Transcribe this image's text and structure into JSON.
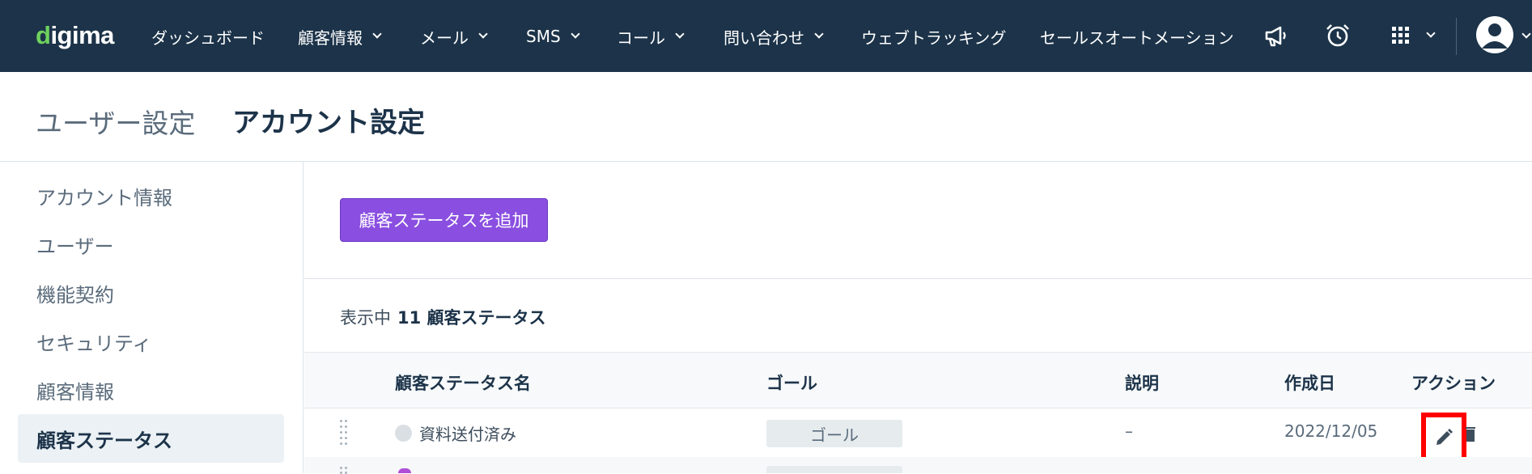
{
  "brand": {
    "logo_text": "digima",
    "leaf_color": "#6fd15e"
  },
  "nav": {
    "items": [
      {
        "label": "ダッシュボード",
        "has_dropdown": false
      },
      {
        "label": "顧客情報",
        "has_dropdown": true
      },
      {
        "label": "メール",
        "has_dropdown": true
      },
      {
        "label": "SMS",
        "has_dropdown": true
      },
      {
        "label": "コール",
        "has_dropdown": true
      },
      {
        "label": "問い合わせ",
        "has_dropdown": true
      },
      {
        "label": "ウェブトラッキング",
        "has_dropdown": false
      },
      {
        "label": "セールスオートメーション",
        "has_dropdown": false
      }
    ],
    "icons": [
      "megaphone-icon",
      "alarm-clock-icon",
      "app-grid-icon",
      "user-avatar-icon"
    ],
    "background": "#1c3349"
  },
  "header": {
    "breadcrumb_parent": "ユーザー設定",
    "page_title": "アカウント設定"
  },
  "sidebar": {
    "items": [
      {
        "label": "アカウント情報",
        "active": false
      },
      {
        "label": "ユーザー",
        "active": false
      },
      {
        "label": "機能契約",
        "active": false
      },
      {
        "label": "セキュリティ",
        "active": false
      },
      {
        "label": "顧客情報",
        "active": false
      },
      {
        "label": "顧客ステータス",
        "active": true
      }
    ]
  },
  "main": {
    "add_button_label": "顧客ステータスを追加",
    "add_button_color": "#8a4fe0",
    "count": {
      "prefix": "表示中",
      "value": "11 顧客ステータス"
    },
    "table": {
      "headers": [
        "顧客ステータス名",
        "ゴール",
        "説明",
        "作成日",
        "アクション"
      ],
      "rows": [
        {
          "name": "資料送付済み",
          "status_color": "#dadfe3",
          "goal": "ゴール",
          "description": "–",
          "created": "2022/12/05",
          "actions": [
            "edit-icon",
            "trash-icon"
          ]
        }
      ]
    }
  },
  "highlight_color": "#ff0000"
}
